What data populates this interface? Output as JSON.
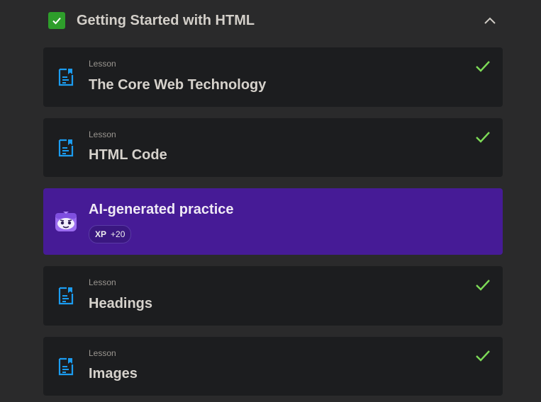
{
  "section": {
    "title": "Getting Started with HTML",
    "completed": true
  },
  "cards": [
    {
      "kind": "Lesson",
      "title": "The Core Web Technology",
      "completed": true,
      "icon": "document-icon"
    },
    {
      "kind": "Lesson",
      "title": "HTML Code",
      "completed": true,
      "icon": "document-icon"
    }
  ],
  "practice": {
    "title": "AI-generated practice",
    "xp_label": "XP",
    "xp_value": "+20",
    "icon": "robot-mascot-icon",
    "color": "#461b96"
  },
  "cards_after": [
    {
      "kind": "Lesson",
      "title": "Headings",
      "completed": true,
      "icon": "document-icon"
    },
    {
      "kind": "Lesson",
      "title": "Images",
      "completed": true,
      "icon": "document-icon"
    }
  ],
  "colors": {
    "accent_blue": "#1b9cf0",
    "check_green": "#7ddb57",
    "section_check": "#2e9e2b"
  }
}
